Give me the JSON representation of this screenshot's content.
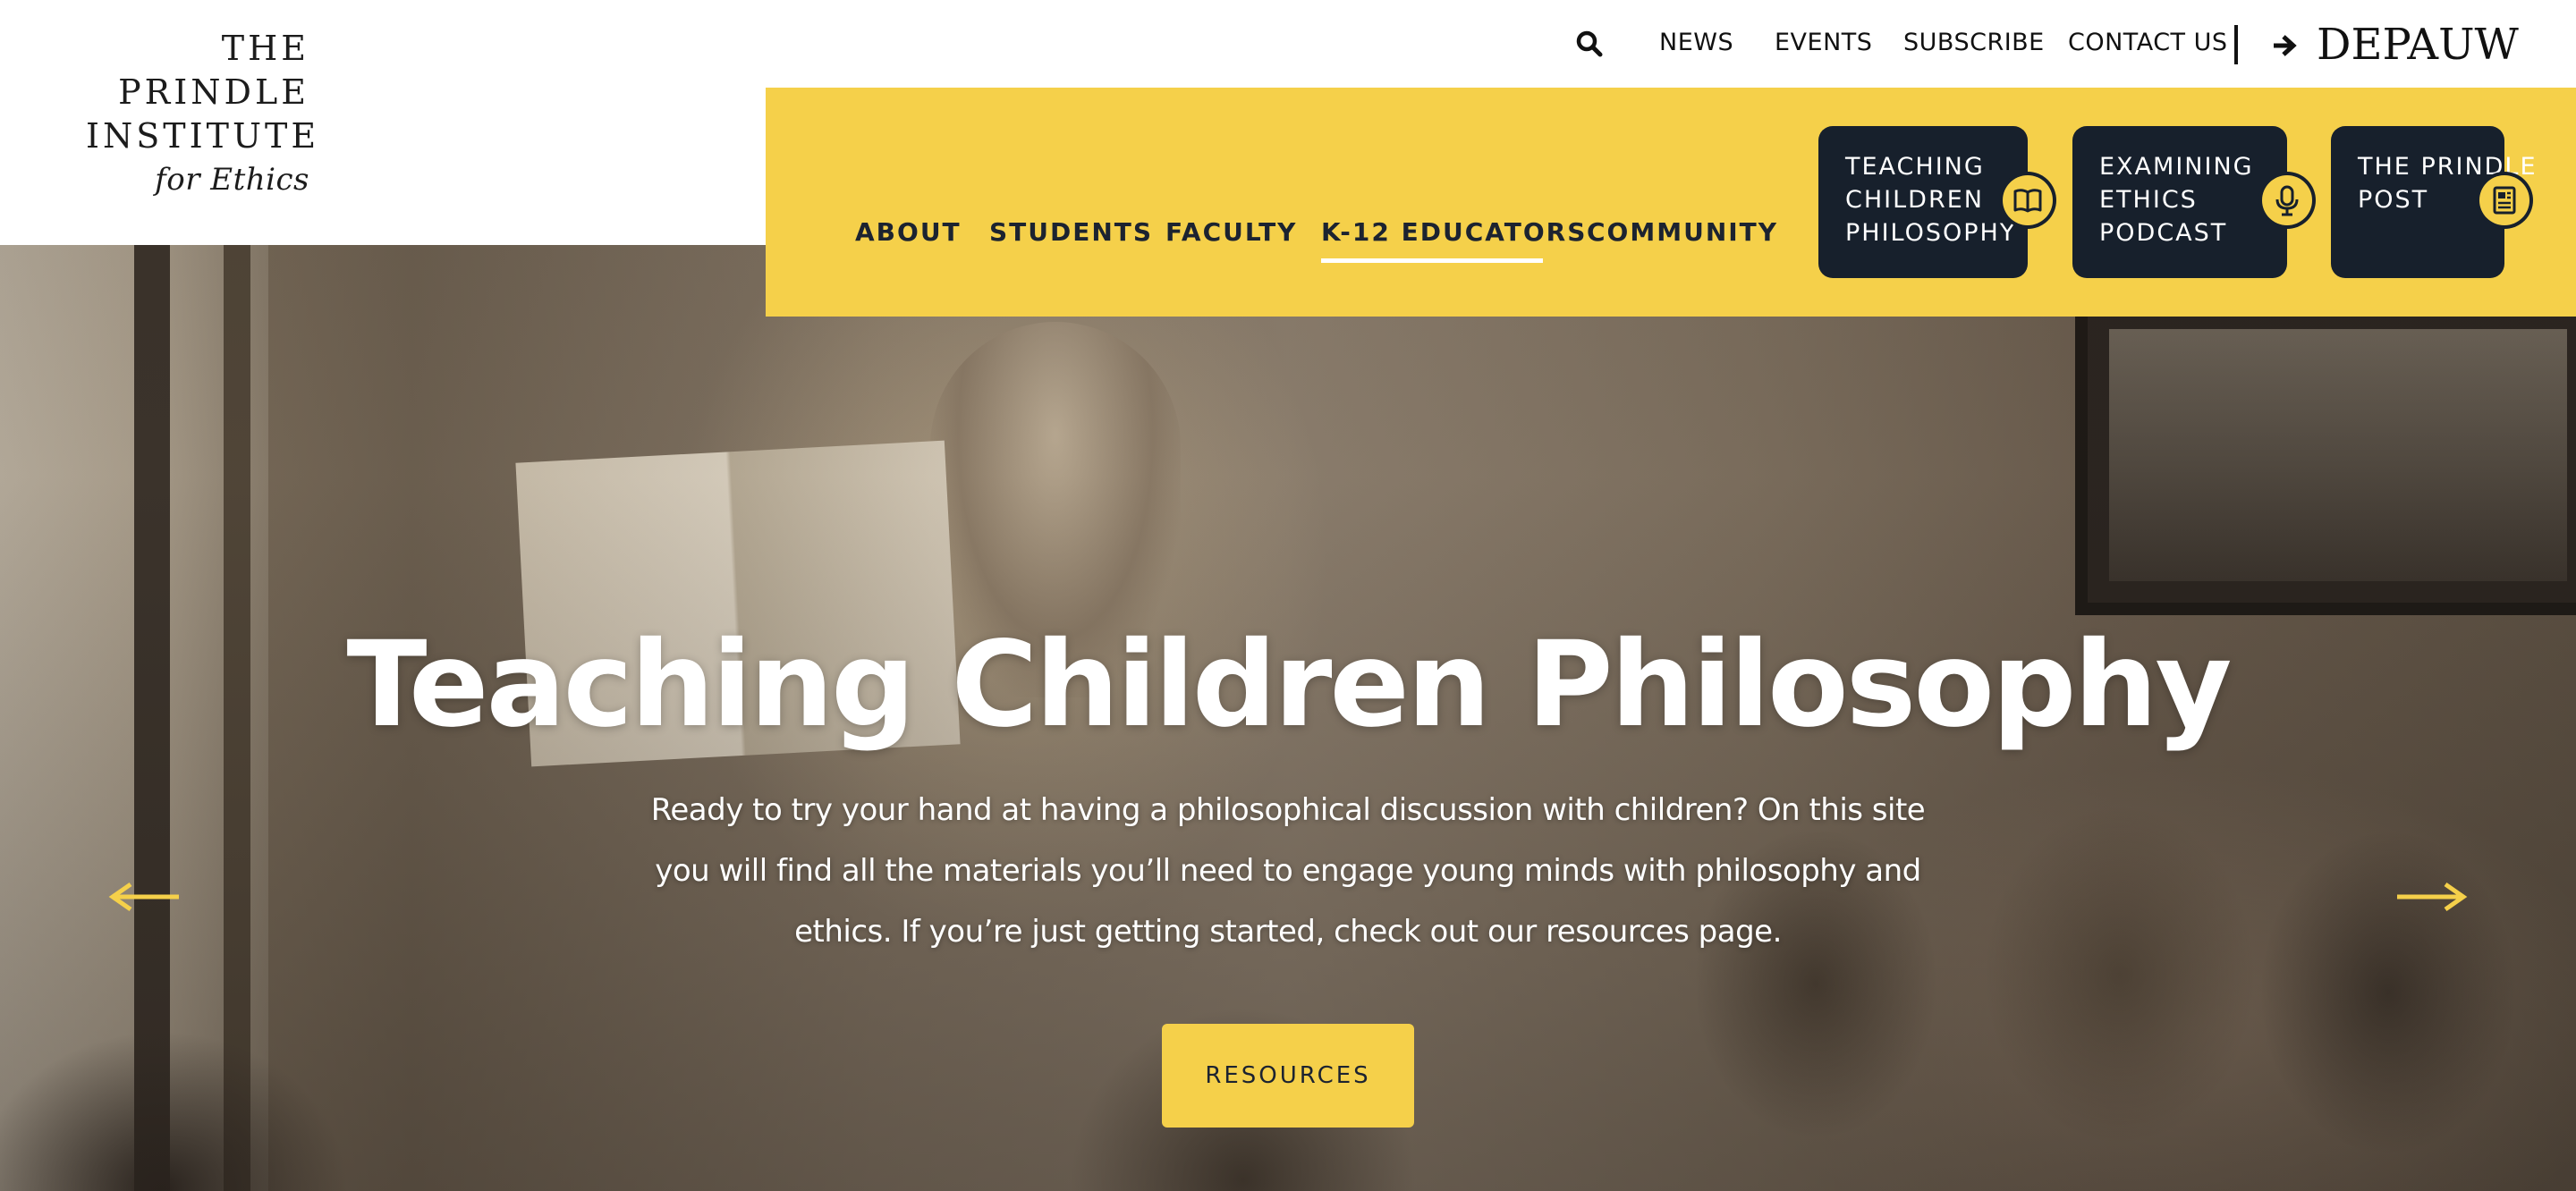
{
  "logo": {
    "line1": "The",
    "line2": "Prindle",
    "line3": "Institute",
    "line4": "for Ethics"
  },
  "top_nav": {
    "search_icon": "search-icon",
    "items": [
      "NEWS",
      "EVENTS",
      "SUBSCRIBE",
      "CONTACT US"
    ],
    "depauw": "DEPAUW"
  },
  "main_nav": {
    "items": [
      "ABOUT",
      "STUDENTS",
      "FACULTY",
      "K-12 EDUCATORS",
      "COMMUNITY"
    ],
    "active": "K-12 EDUCATORS"
  },
  "features": [
    {
      "label": "TEACHING CHILDREN PHILOSOPHY",
      "icon": "book-icon"
    },
    {
      "label": "EXAMINING ETHICS PODCAST",
      "icon": "microphone-icon"
    },
    {
      "label": "THE PRINDLE POST",
      "icon": "newspaper-icon"
    }
  ],
  "hero": {
    "title": "Teaching Children Philosophy",
    "text": "Ready to try your hand at having a philosophical discussion with children? On this site you will find all the materials you’ll need to engage young minds with philosophy and ethics. If you’re just getting started, check out our resources page.",
    "button": "RESOURCES",
    "prev_icon": "arrow-left-icon",
    "next_icon": "arrow-right-icon"
  },
  "colors": {
    "accent_yellow": "#f5d04a",
    "navy": "#17202c",
    "text_dark": "#1c2330"
  }
}
